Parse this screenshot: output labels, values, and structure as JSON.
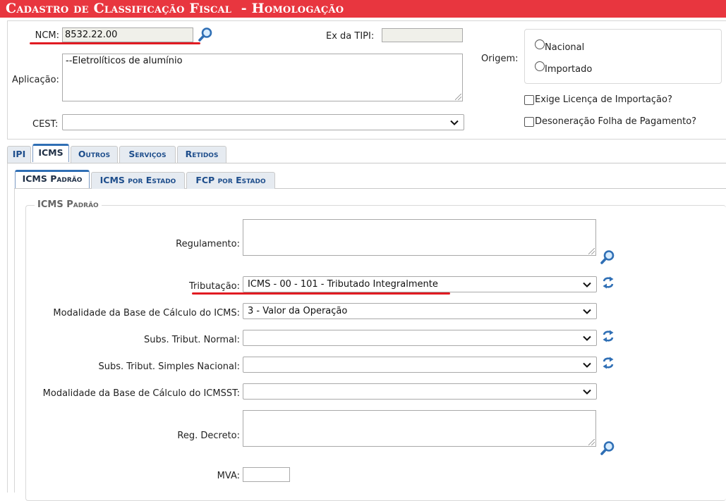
{
  "window": {
    "title": "Cadastro de Classificação Fiscal  - Homologação"
  },
  "header": {
    "ncm_label": "NCM:",
    "ncm_value": "8532.22.00",
    "ex_tipi_label": "Ex da TIPI:",
    "ex_tipi_value": "",
    "aplicacao_label": "Aplicação:",
    "aplicacao_value": "--Eletrolíticos de alumínio",
    "cest_label": "CEST:",
    "cest_value": "",
    "origem_label": "Origem:",
    "origem_options": [
      "Nacional",
      "Importado"
    ],
    "exige_licenca_label": "Exige Licença de Importação?",
    "desoneracao_label": "Desoneração Folha de Pagamento?"
  },
  "tabs": [
    {
      "label": "IPI",
      "active": false
    },
    {
      "label": "ICMS",
      "active": true
    },
    {
      "label": "Outros",
      "active": false
    },
    {
      "label": "Serviços",
      "active": false
    },
    {
      "label": "Retidos",
      "active": false
    }
  ],
  "subtabs": [
    {
      "label": "ICMS Padrão",
      "active": true
    },
    {
      "label": "ICMS por Estado",
      "active": false
    },
    {
      "label": "FCP por Estado",
      "active": false
    }
  ],
  "icms_padrao": {
    "legend": "ICMS Padrão",
    "regulamento_label": "Regulamento:",
    "regulamento_value": "",
    "tributacao_label": "Tributação:",
    "tributacao_value": "ICMS - 00 - 101 - Tributado Integralmente",
    "modalidade_bc_label": "Modalidade da Base de Cálculo do ICMS:",
    "modalidade_bc_value": "3 - Valor da Operação",
    "subs_normal_label": "Subs. Tribut. Normal:",
    "subs_normal_value": "",
    "subs_simples_label": "Subs. Tribut. Simples Nacional:",
    "subs_simples_value": "",
    "modalidade_bcst_label": "Modalidade da Base de Cálculo do ICMSST:",
    "modalidade_bcst_value": "",
    "reg_decreto_label": "Reg. Decreto:",
    "reg_decreto_value": "",
    "mva_label": "MVA:",
    "mva_value": ""
  },
  "colors": {
    "titlebar": "#e8363f",
    "tab_text": "#1e4e8c",
    "annotation_red": "#e11b22",
    "icon_blue": "#2f6fb5"
  },
  "icons": {
    "search": "magnifier-icon",
    "refresh": "refresh-arrows-icon",
    "dropdown": "chevron-down-icon"
  }
}
